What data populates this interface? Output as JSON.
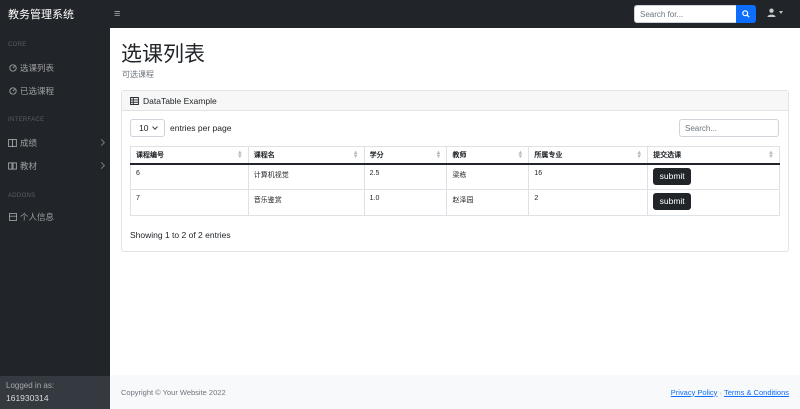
{
  "navbar": {
    "brand": "教务管理系统",
    "toggle_icon": "bars-icon",
    "search_placeholder": "Search for...",
    "search_icon": "search-icon",
    "user_icon": "user-icon",
    "accent_color": "#0d6efd"
  },
  "sidebar": {
    "sections": {
      "core": "CORE",
      "interface": "INTERFACE",
      "addons": "ADDONS"
    },
    "items": [
      {
        "label": "选课列表",
        "icon": "gauge-icon"
      },
      {
        "label": "已选课程",
        "icon": "gauge-icon"
      },
      {
        "label": "成绩",
        "icon": "columns-icon"
      },
      {
        "label": "教材",
        "icon": "book-icon"
      },
      {
        "label": "个人信息",
        "icon": "table-icon"
      }
    ],
    "footer_label": "Logged in as:",
    "footer_user": "161930314"
  },
  "main": {
    "title": "选课列表",
    "subtitle": "可选课程",
    "card_header": "DataTable Example",
    "length_value": "10",
    "length_label": "entries per page",
    "search_placeholder": "Search...",
    "columns": [
      "课程编号",
      "课程名",
      "学分",
      "教师",
      "所属专业",
      "提交选课"
    ],
    "rows": [
      {
        "id": "6",
        "name": "计算机视觉",
        "credit": "2.5",
        "teacher": "梁栋",
        "major": "16",
        "action": "submit"
      },
      {
        "id": "7",
        "name": "音乐鉴赏",
        "credit": "1.0",
        "teacher": "赵泽园",
        "major": "2",
        "action": "submit"
      }
    ],
    "info": "Showing 1 to 2 of 2 entries"
  },
  "footer": {
    "copyright": "Copyright © Your Website 2022",
    "privacy": "Privacy Policy",
    "separator": "·",
    "terms": "Terms & Conditions"
  }
}
